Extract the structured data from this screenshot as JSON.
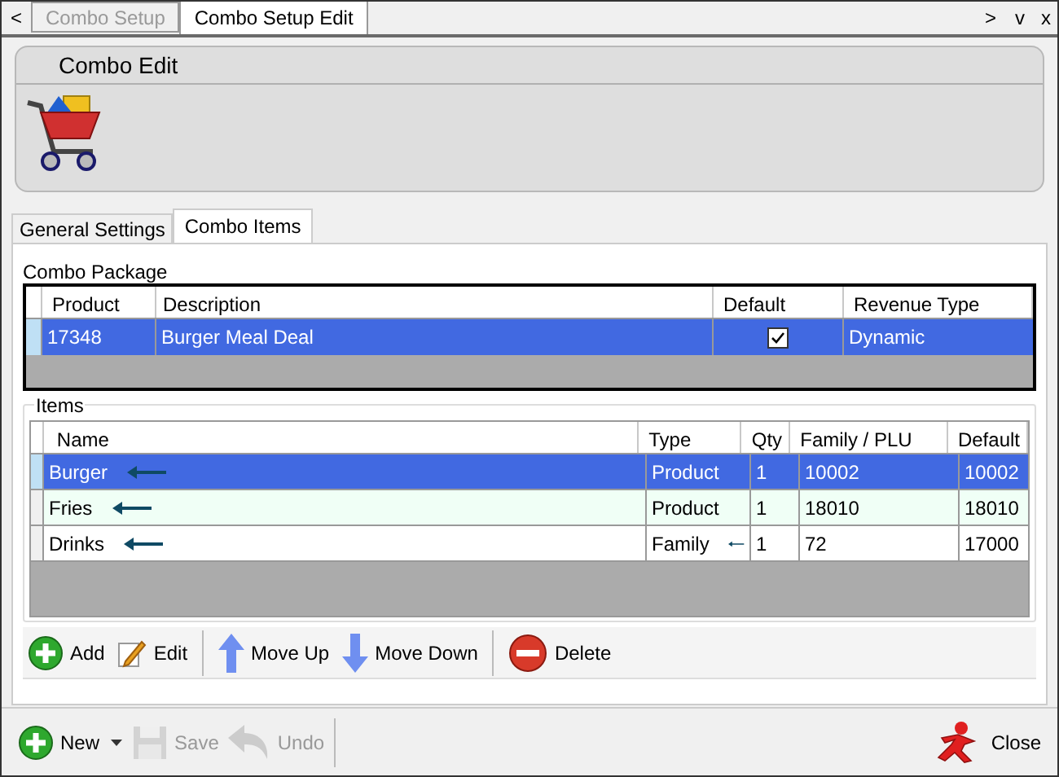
{
  "doc_tabs": [
    {
      "label": "Combo Setup",
      "selected": false
    },
    {
      "label": "Combo Setup Edit",
      "selected": true
    }
  ],
  "nav": {
    "prev": "<",
    "next": ">",
    "menu": "v",
    "close": "x"
  },
  "header": {
    "title": "Combo Edit"
  },
  "tabs": [
    {
      "label": "General Settings",
      "selected": false
    },
    {
      "label": "Combo Items",
      "selected": true
    }
  ],
  "combo_package": {
    "label": "Combo Package",
    "columns": [
      "Product",
      "Description",
      "Default",
      "Revenue Type"
    ],
    "rows": [
      {
        "product": "17348",
        "description": "Burger Meal Deal",
        "default": true,
        "revenue_type": "Dynamic",
        "selected": true
      }
    ]
  },
  "items": {
    "label": "Items",
    "columns": [
      "Name",
      "Type",
      "Qty",
      "Family / PLU",
      "Default"
    ],
    "rows": [
      {
        "name": "Burger",
        "type": "Product",
        "qty": "1",
        "family_plu": "10002",
        "default": "10002",
        "selected": true,
        "name_marked": true,
        "type_marked": false
      },
      {
        "name": "Fries",
        "type": "Product",
        "qty": "1",
        "family_plu": "18010",
        "default": "18010",
        "selected": false,
        "name_marked": true,
        "type_marked": false
      },
      {
        "name": "Drinks",
        "type": "Family",
        "qty": "1",
        "family_plu": "72",
        "default": "17000",
        "selected": false,
        "name_marked": true,
        "type_marked": true
      }
    ]
  },
  "item_toolbar": [
    {
      "kind": "add",
      "label": "Add"
    },
    {
      "kind": "edit",
      "label": "Edit"
    },
    {
      "kind": "sep"
    },
    {
      "kind": "up",
      "label": "Move Up"
    },
    {
      "kind": "down",
      "label": "Move Down"
    },
    {
      "kind": "sep"
    },
    {
      "kind": "delete",
      "label": "Delete"
    }
  ],
  "footer": [
    {
      "kind": "new",
      "label": "New",
      "disabled": false
    },
    {
      "kind": "save",
      "label": "Save",
      "disabled": true
    },
    {
      "kind": "undo",
      "label": "Undo",
      "disabled": true
    }
  ],
  "close": {
    "label": "Close"
  }
}
